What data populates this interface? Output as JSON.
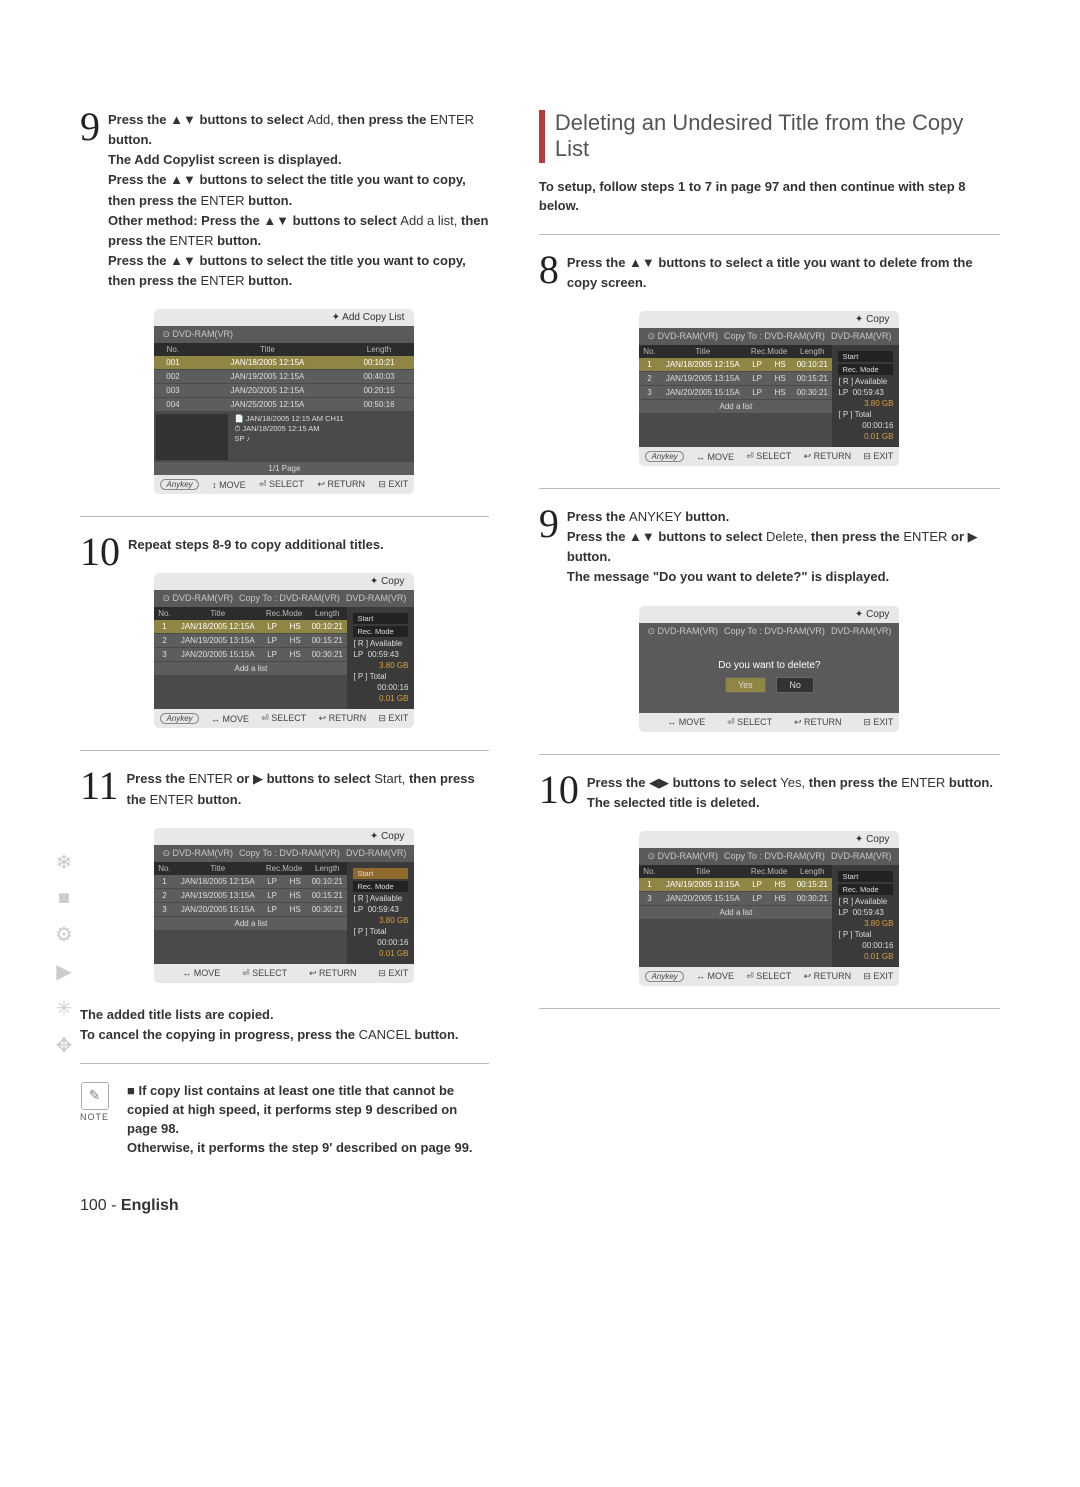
{
  "left": {
    "step9": {
      "l1a": "Press the ",
      "l1b": " buttons to select ",
      "add": "Add,",
      "l1c": " then press the ",
      "enter": "ENTER",
      "l1d": " button.",
      "l2": "The Add Copylist screen is displayed.",
      "l3a": "Press the ",
      "l3b": " buttons to select the title you want to copy, then press the ",
      "l3enter": "ENTER",
      "l3c": " button.",
      "l4a": "Other method: Press the ",
      "l4b": " buttons to select ",
      "addalist": "Add a list,",
      "l4c": " then press the ",
      "l4enter": "ENTER",
      "l4d": " button.",
      "l5a": "Press the ",
      "l5b": " buttons to select the title you want to copy, then press the ",
      "l5enter": "ENTER",
      "l5c": " button."
    },
    "step10": "Repeat steps 8-9 to copy additional titles.",
    "step11": {
      "a": "Press the ",
      "enter": "ENTER",
      "b": " or ",
      "c": " buttons to select ",
      "start": "Start,",
      "d": " then press the ",
      "e": " button."
    },
    "afterText1": "The added title lists are copied.",
    "afterText2a": "To cancel the copying in progress, press the ",
    "cancel": "CANCEL",
    "afterText2b": " button.",
    "note": {
      "l1": "If copy list contains at least one title that cannot be copied at high speed, it performs step 9 described on page 98.",
      "l2": "Otherwise, it performs the step 9' described on page 99.",
      "label": "NOTE"
    }
  },
  "right": {
    "title": "Deleting an Undesired Title from the Copy List",
    "intro": "To setup, follow steps 1 to 7 in page 97 and then continue with step 8 below.",
    "step8": {
      "a": "Press the ",
      "b": " buttons to select a title you want to delete from the copy screen."
    },
    "step9": {
      "l1a": "Press the ",
      "anykey": "ANYKEY",
      "l1b": " button.",
      "l2a": "Press the ",
      "l2b": " buttons to select ",
      "del": "Delete,",
      "l2c": " then press the ",
      "enter": "ENTER",
      "l2d": " or ",
      "l2e": " button.",
      "l3": "The message \"Do you want to delete?\" is displayed."
    },
    "step10": {
      "a": "Press the ",
      "b": " buttons to select ",
      "yes": "Yes,",
      "c": " then press the ",
      "enter": "ENTER",
      "d": " button.",
      "e": "The selected title is deleted."
    }
  },
  "ui": {
    "addCopyList": "Add Copy List",
    "copy": "Copy",
    "dvdram": "DVD-RAM(VR)",
    "copyTo": "Copy To : DVD-RAM(VR)",
    "no": "No.",
    "titleH": "Title",
    "length": "Length",
    "recmode": "Rec.Mode",
    "rows": [
      {
        "n": "001",
        "t": "JAN/18/2005 12:15A",
        "l": "00:10:21"
      },
      {
        "n": "002",
        "t": "JAN/19/2005 12:15A",
        "l": "00:40:03"
      },
      {
        "n": "003",
        "t": "JAN/20/2005 12:15A",
        "l": "00:20:15"
      },
      {
        "n": "004",
        "t": "JAN/25/2005 12:15A",
        "l": "00:50:16"
      }
    ],
    "modeLP": "LP",
    "modeHS": "HS",
    "start": "Start",
    "recModeLbl": "Rec. Mode",
    "avail": "[ R ] Available",
    "availLP": "LP",
    "availT": "00:59:43",
    "availG": "3.80 GB",
    "pTotal": "[ P ] Total",
    "pT": "00:00:16",
    "pG": "0.01 GB",
    "page": "1/1 Page",
    "addAList": "Add a list",
    "meta1": "JAN/18/2005 12:15 AM CH11",
    "meta2": "JAN/18/2005 12:15 AM",
    "meta3": "SP",
    "footer": {
      "anykey": "Anykey",
      "move": "MOVE",
      "select": "SELECT",
      "return": "RETURN",
      "exit": "EXIT"
    },
    "dialogQ": "Do you want to delete?",
    "yes": "Yes",
    "no_btn": "No",
    "rowsShort": [
      {
        "n": "1",
        "t": "JAN/18/2005 12:15A",
        "lp": "LP",
        "hs": "HS",
        "l": "00:10:21"
      },
      {
        "n": "2",
        "t": "JAN/19/2005 13:15A",
        "lp": "LP",
        "hs": "HS",
        "l": "00:15:21"
      },
      {
        "n": "3",
        "t": "JAN/20/2005 15:15A",
        "lp": "LP",
        "hs": "HS",
        "l": "00:30:21"
      }
    ],
    "rowsTwo": [
      {
        "n": "1",
        "t": "JAN/19/2005 13:15A",
        "lp": "LP",
        "hs": "HS",
        "l": "00:15:21"
      },
      {
        "n": "3",
        "t": "JAN/20/2005 15:15A",
        "lp": "LP",
        "hs": "HS",
        "l": "00:30:21"
      }
    ]
  },
  "footer": {
    "num": "100 - ",
    "eng": "English"
  }
}
